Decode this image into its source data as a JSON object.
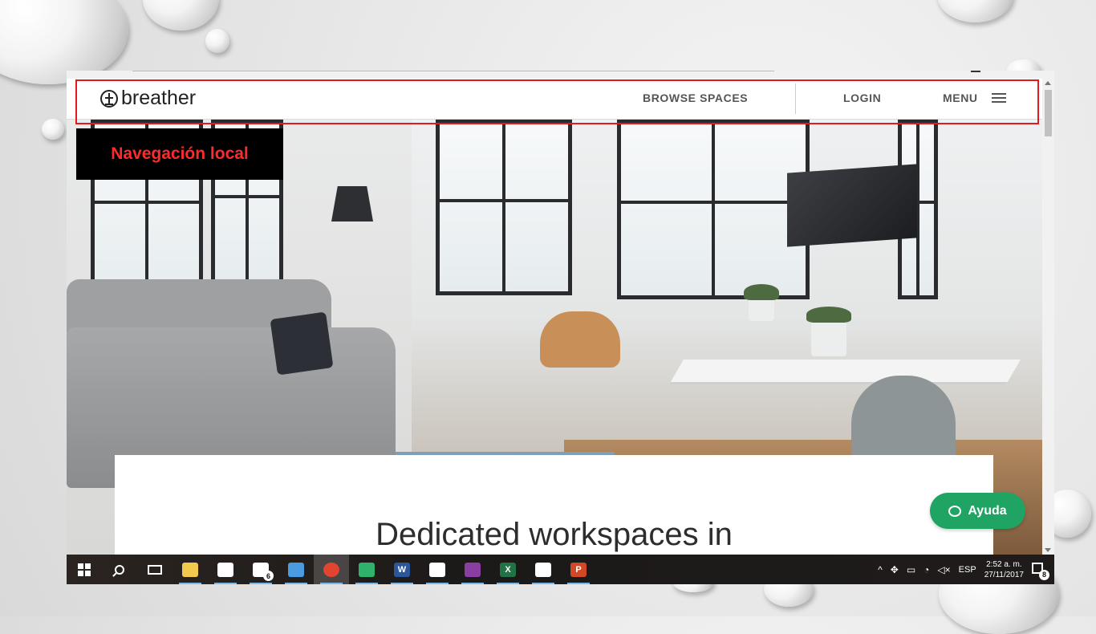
{
  "site": {
    "logo_text": "breather",
    "nav": {
      "browse": "BROWSE SPACES",
      "login": "LOGIN",
      "menu": "MENU"
    },
    "annotation_label": "Navegación local",
    "heading": "Dedicated workspaces in",
    "help_button": "Ayuda"
  },
  "taskbar": {
    "apps": [
      {
        "name": "file-explorer",
        "color": "#f2c94c"
      },
      {
        "name": "store",
        "color": "#ffffff"
      },
      {
        "name": "mail",
        "color": "#ffffff",
        "badge": "6"
      },
      {
        "name": "notes",
        "color": "#4a9be0"
      },
      {
        "name": "chrome",
        "color": "#e2452f"
      },
      {
        "name": "app-green",
        "color": "#2fb36b"
      },
      {
        "name": "word",
        "color": "#2b579a",
        "letter": "W"
      },
      {
        "name": "paint",
        "color": "#ffffff"
      },
      {
        "name": "winrar",
        "color": "#8a3ea1"
      },
      {
        "name": "excel",
        "color": "#217346",
        "letter": "X"
      },
      {
        "name": "photos",
        "color": "#ffffff"
      },
      {
        "name": "powerpoint",
        "color": "#d24726",
        "letter": "P"
      }
    ],
    "tray": {
      "language": "ESP",
      "time": "2:52 a. m.",
      "date": "27/11/2017",
      "notification_count": "8"
    }
  },
  "colors": {
    "highlight": "#e3191f",
    "label_text": "#ff2a2a",
    "help_green": "#1fa463"
  }
}
